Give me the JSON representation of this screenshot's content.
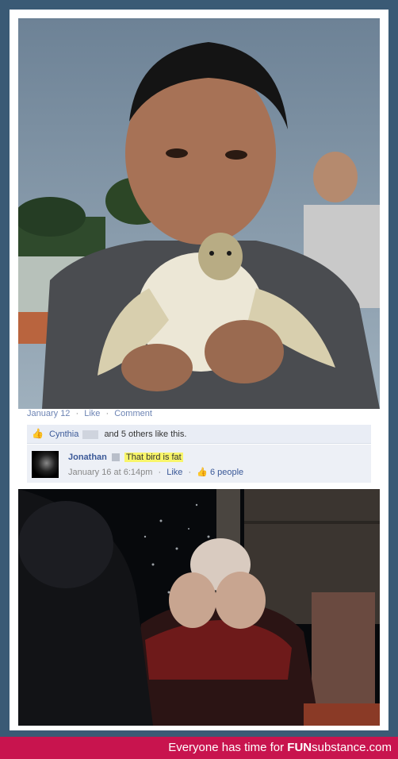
{
  "post": {
    "date_label": "January 12",
    "like_link": "Like",
    "comment_link": "Comment",
    "separator": "·"
  },
  "likes": {
    "name": "Cynthia",
    "rest": "and 5 others like this."
  },
  "comment": {
    "author": "Jonathan",
    "text": "That bird is fat",
    "timestamp": "January 16 at 6:14pm",
    "like_link": "Like",
    "likes_count": "6 people"
  },
  "footer": {
    "prefix": "Everyone has time for ",
    "brand_bold": "FUN",
    "brand_rest": "substance.com"
  },
  "colors": {
    "frame": "#3a5a75",
    "facebook_link": "#3b5998",
    "highlight": "#f8f56a",
    "footer_bar": "#c8144e"
  }
}
